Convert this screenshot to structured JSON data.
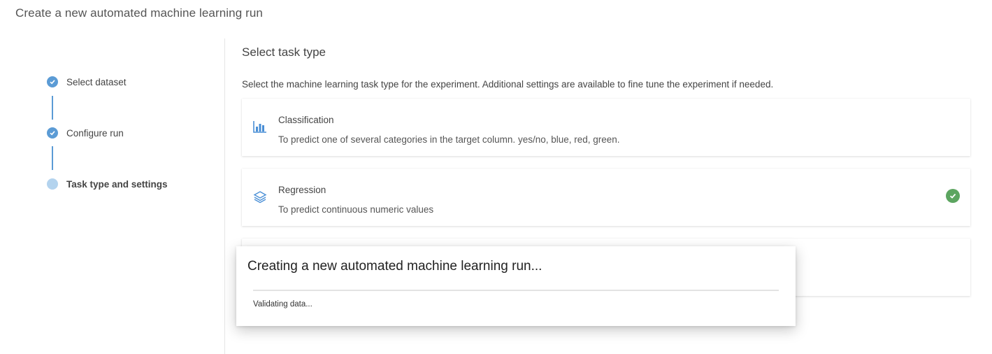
{
  "page_title": "Create a new automated machine learning run",
  "steps": [
    {
      "label": "Select dataset",
      "status": "complete"
    },
    {
      "label": "Configure run",
      "status": "complete"
    },
    {
      "label": "Task type and settings",
      "status": "current"
    }
  ],
  "section": {
    "title": "Select task type",
    "description": "Select the machine learning task type for the experiment. Additional settings are available to fine tune the experiment if needed."
  },
  "task_types": [
    {
      "title": "Classification",
      "description": "To predict one of several categories in the target column. yes/no, blue, red, green.",
      "icon": "bar-chart-icon",
      "selected": false
    },
    {
      "title": "Regression",
      "description": "To predict continuous numeric values",
      "icon": "layers-icon",
      "selected": true
    },
    {
      "title": "",
      "description": "",
      "icon": "",
      "selected": false
    }
  ],
  "dialog": {
    "title": "Creating a new automated machine learning run...",
    "status": "Validating data...",
    "progress": 0
  },
  "colors": {
    "step_complete": "#5b9bd5",
    "step_pending": "#b3d3ee",
    "icon_blue": "#4a8fd6",
    "selected_check": "#5ca560"
  }
}
